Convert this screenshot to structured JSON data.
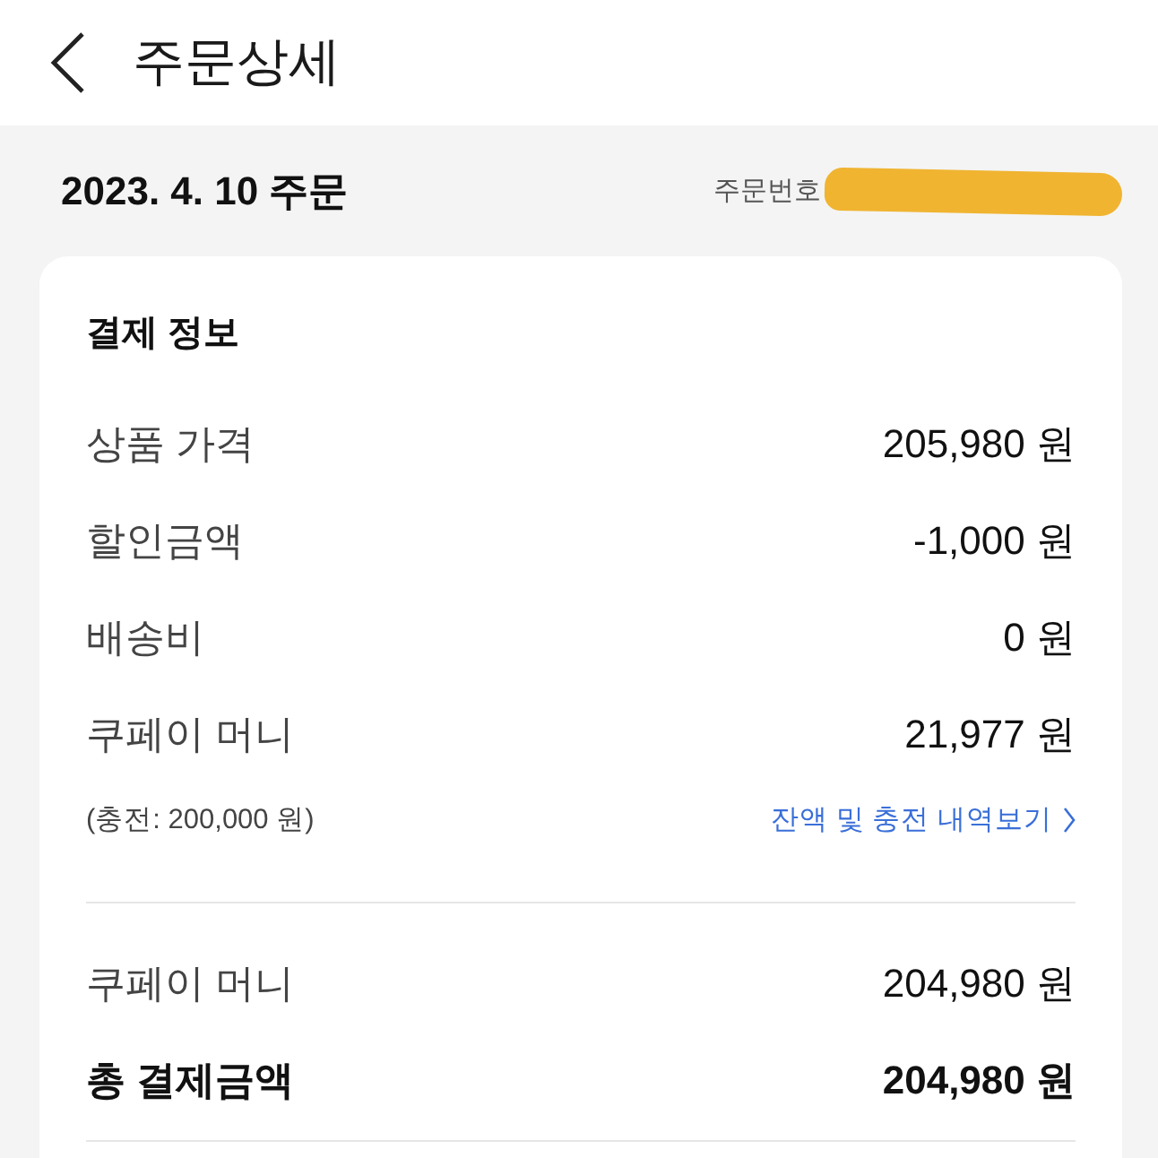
{
  "header": {
    "title": "주문상세"
  },
  "order": {
    "date": "2023. 4. 10 주문",
    "number_label": "주문번호"
  },
  "payment": {
    "title": "결제 정보",
    "rows": [
      {
        "label": "상품 가격",
        "value": "205,980 원"
      },
      {
        "label": "할인금액",
        "value": "-1,000 원"
      },
      {
        "label": "배송비",
        "value": "0 원"
      },
      {
        "label": "쿠페이 머니",
        "value": "21,977 원"
      }
    ],
    "charge_note": "(충전: 200,000 원)",
    "history_link": "잔액 및 충전 내역보기",
    "summary": [
      {
        "kind": "normal",
        "label": "쿠페이 머니",
        "value": "204,980 원"
      },
      {
        "kind": "total",
        "label": "총 결제금액",
        "value": "204,980 원"
      }
    ]
  }
}
